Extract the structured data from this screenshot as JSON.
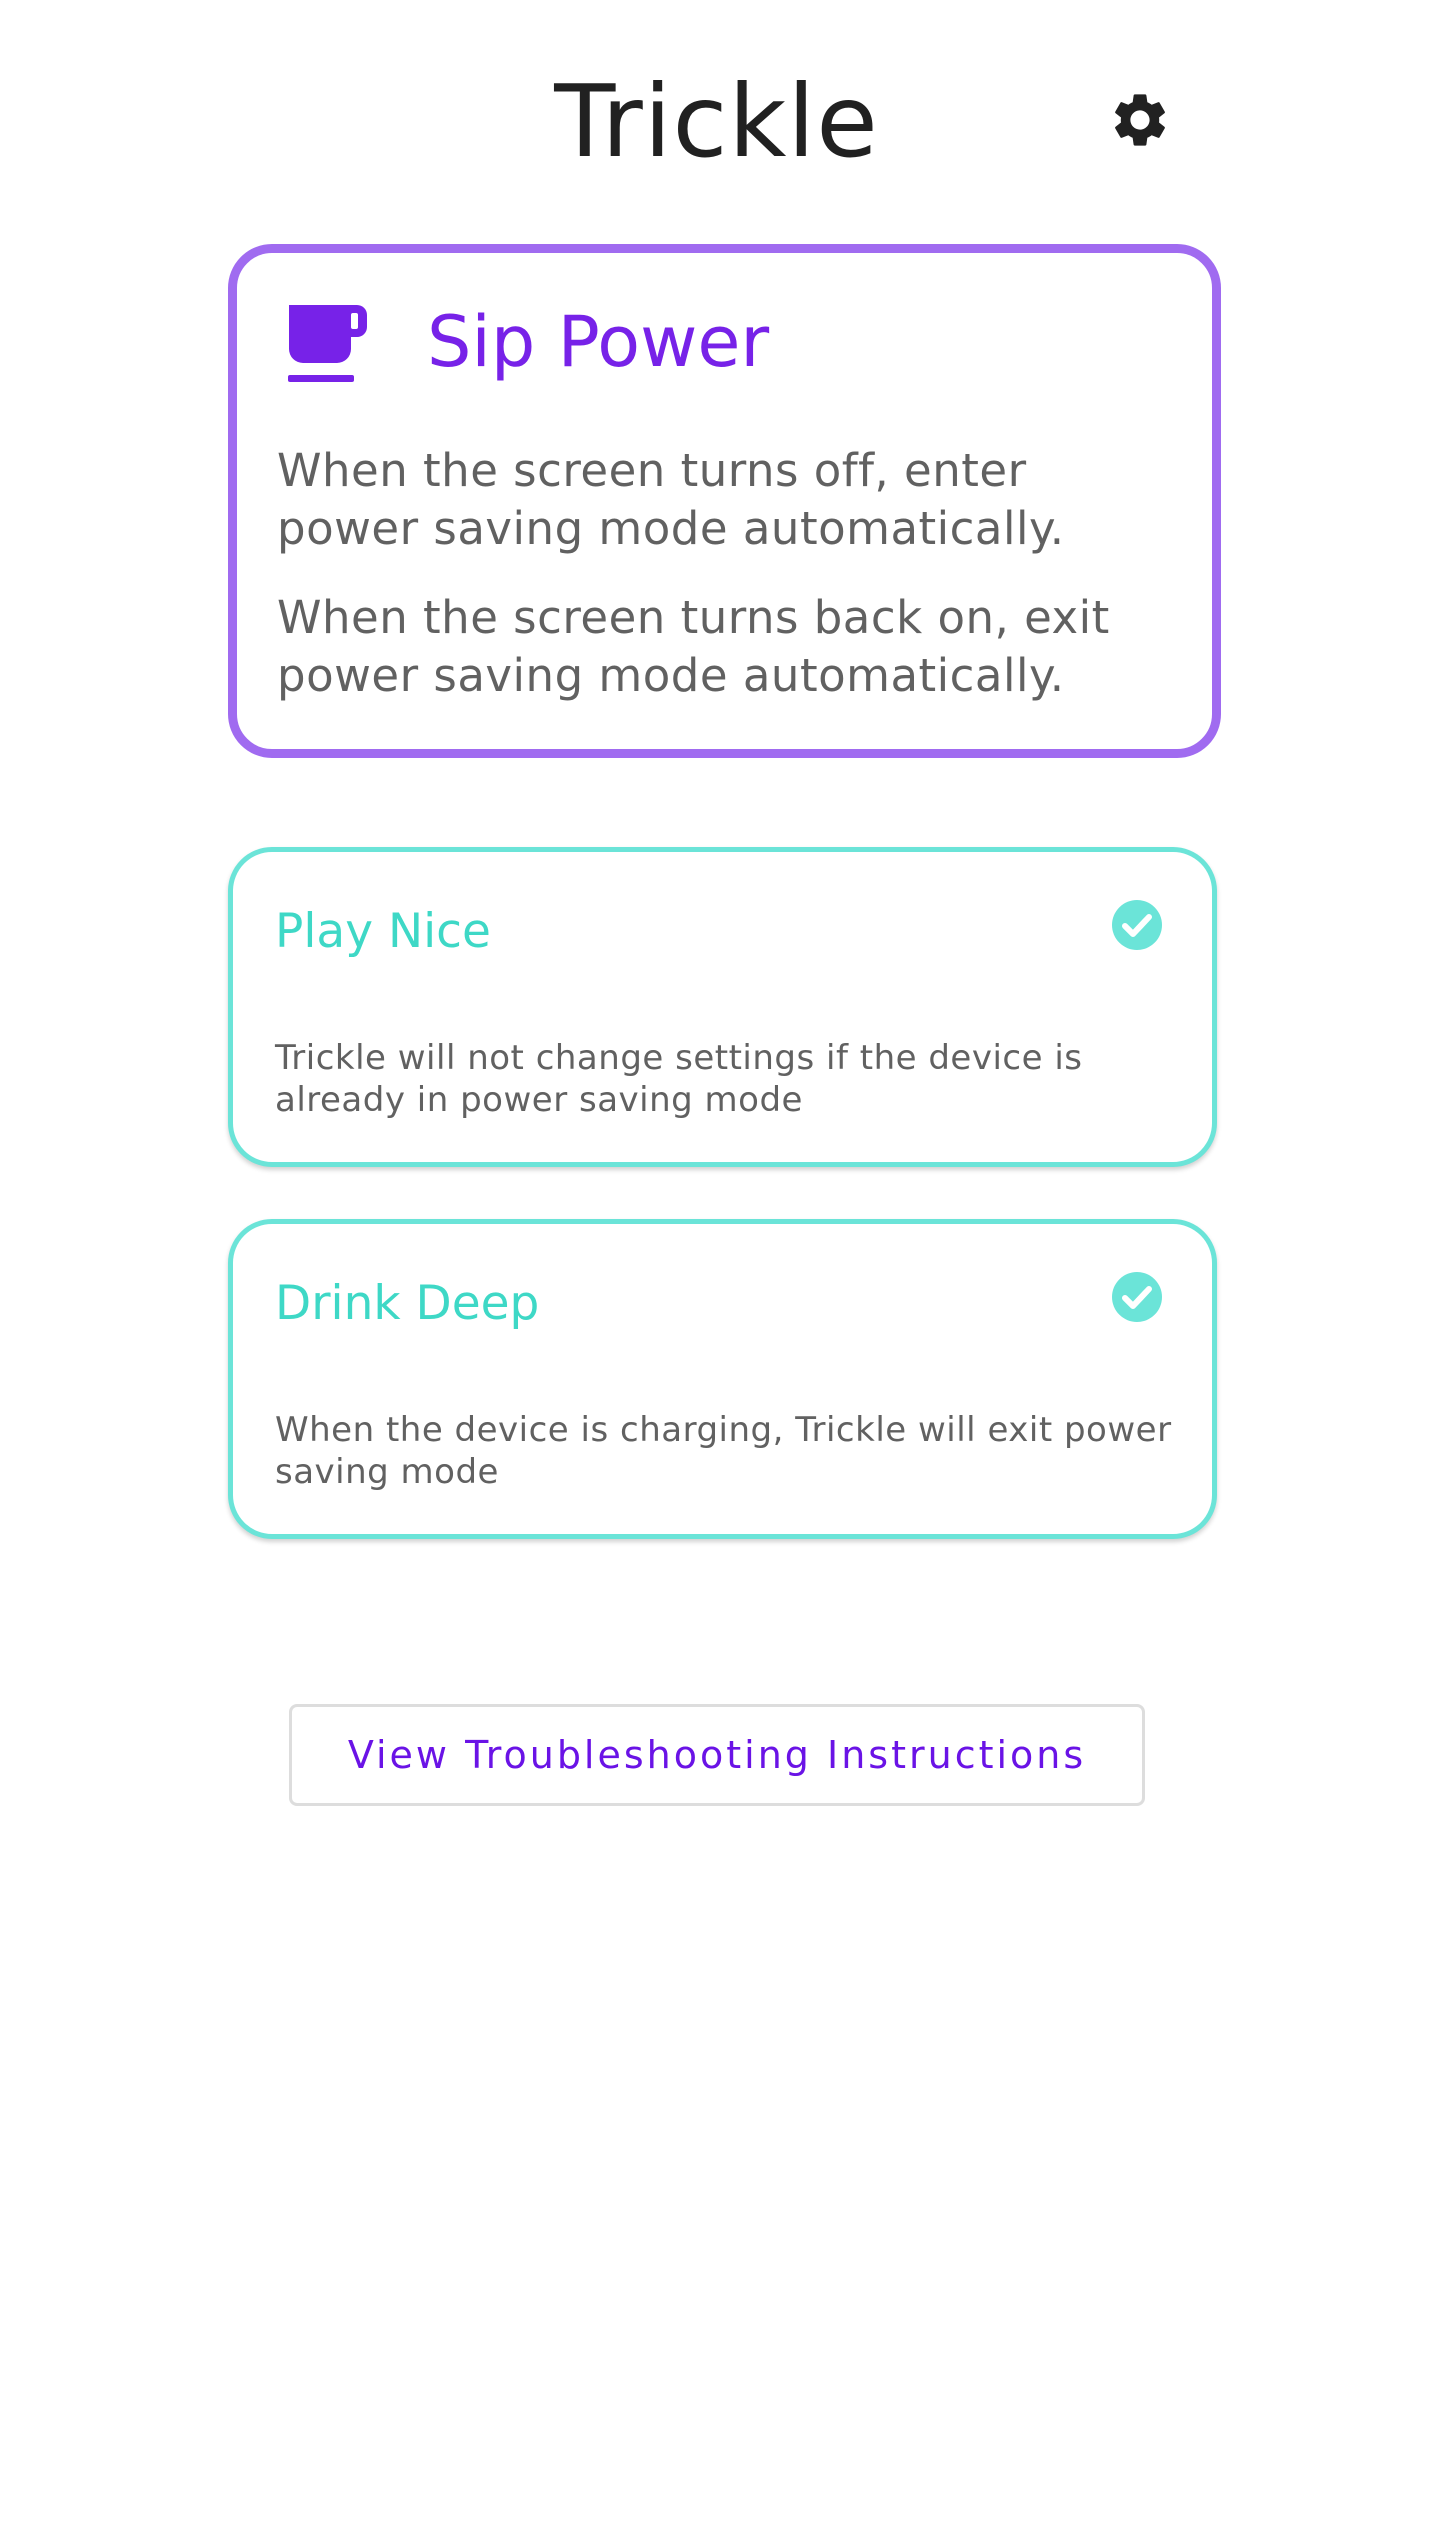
{
  "app": {
    "title": "Trickle"
  },
  "header": {
    "settings_icon": "gear-icon"
  },
  "sip_power": {
    "icon": "coffee-cup-icon",
    "title": "Sip Power",
    "description_1": "When the screen turns off, enter power saving mode automatically.",
    "description_2": "When the screen turns back on, exit power saving mode automatically.",
    "border_color": "#a06bf0",
    "title_color": "#7722e8"
  },
  "options": {
    "play_nice": {
      "title": "Play Nice",
      "description": "Trickle will not change settings if the device is already in power saving mode",
      "checked": true,
      "icon": "check-circle-icon"
    },
    "drink_deep": {
      "title": "Drink Deep",
      "description": "When the device is charging, Trickle will exit power saving mode",
      "checked": true,
      "icon": "check-circle-icon"
    },
    "accent_color": "#6be4d8"
  },
  "troubleshooting": {
    "button_label": "View Troubleshooting Instructions",
    "text_color": "#6a13e6"
  }
}
